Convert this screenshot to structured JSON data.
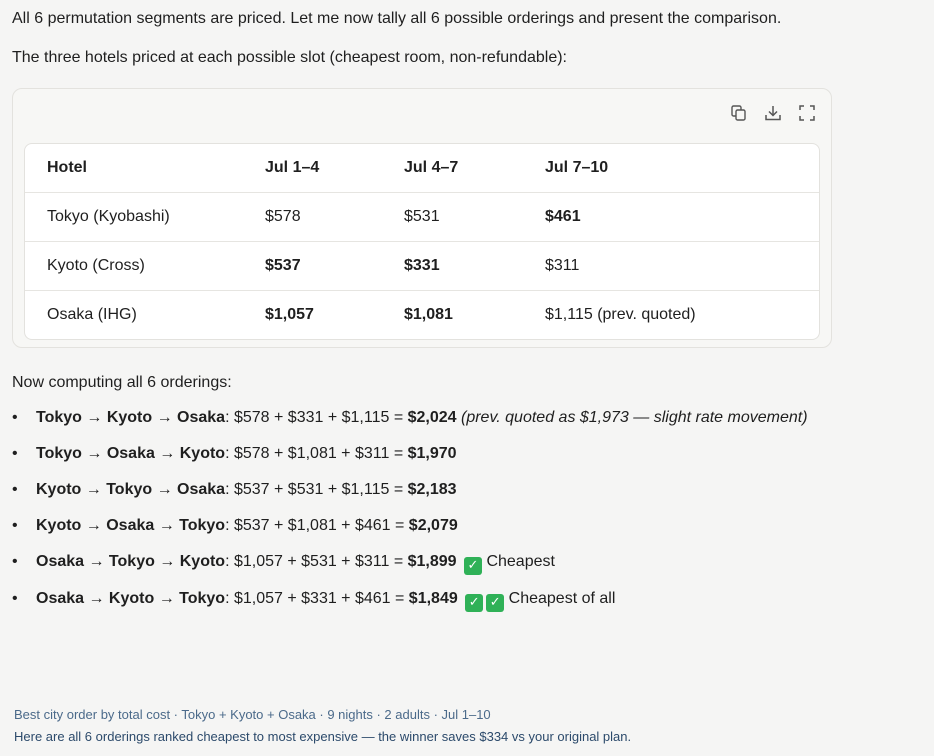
{
  "intro": "All 6 permutation segments are priced. Let me now tally all 6 possible orderings and present the comparison.",
  "table_intro": "The three hotels priced at each possible slot (cheapest room, non-refundable):",
  "toolbar": {
    "icons": [
      "copy-icon",
      "download-icon",
      "expand-icon"
    ]
  },
  "table": {
    "headers": [
      "Hotel",
      "Jul 1–4",
      "Jul 4–7",
      "Jul 7–10"
    ],
    "rows": [
      [
        "Tokyo (Kyobashi)",
        "$578",
        "$531",
        "$461"
      ],
      [
        "Kyoto (Cross)",
        "$537",
        "$331",
        "$311"
      ],
      [
        "Osaka (IHG)",
        "$1,057",
        "$1,081",
        "$1,115 (prev. quoted)"
      ]
    ]
  },
  "computing_label": "Now computing all 6 orderings:",
  "orderings": [
    {
      "route": "Tokyo → Kyoto → Osaka",
      "calc": ": $578 + $331 + $1,115 = ",
      "total": "$2,024",
      "note": "(prev. quoted as $1,973 — slight rate movement)",
      "tag": ""
    },
    {
      "route": "Tokyo → Osaka → Kyoto",
      "calc": ": $578 + $1,081 + $311 = ",
      "total": "$1,970",
      "note": "",
      "tag": ""
    },
    {
      "route": "Kyoto → Tokyo → Osaka",
      "calc": ": $537 + $531 + $1,115 = ",
      "total": "$2,183",
      "note": "",
      "tag": ""
    },
    {
      "route": "Kyoto → Osaka → Tokyo",
      "calc": ": $537 + $1,081 + $461 = ",
      "total": "$2,079",
      "note": "",
      "tag": ""
    },
    {
      "route": "Osaka → Tokyo → Kyoto",
      "calc": ": $1,057 + $531 + $311 = ",
      "total": "$1,899",
      "note": "",
      "tag": "Cheapest"
    },
    {
      "route": "Osaka → Kyoto → Tokyo",
      "calc": ": $1,057 + $331 + $461 = ",
      "total": "$1,849",
      "note": "",
      "tag": "Cheapest of all"
    }
  ],
  "check_glyph": "✓",
  "footer": {
    "line1": "Best city order by total cost · Tokyo + Kyoto + Osaka · 9 nights · 2 adults · Jul 1–10",
    "line2": "Here are all 6 orderings ranked cheapest to most expensive — the winner saves $334 vs your original plan."
  },
  "colors": {
    "check_green": "#2fb157",
    "footer_text": "#4b6a8a"
  }
}
